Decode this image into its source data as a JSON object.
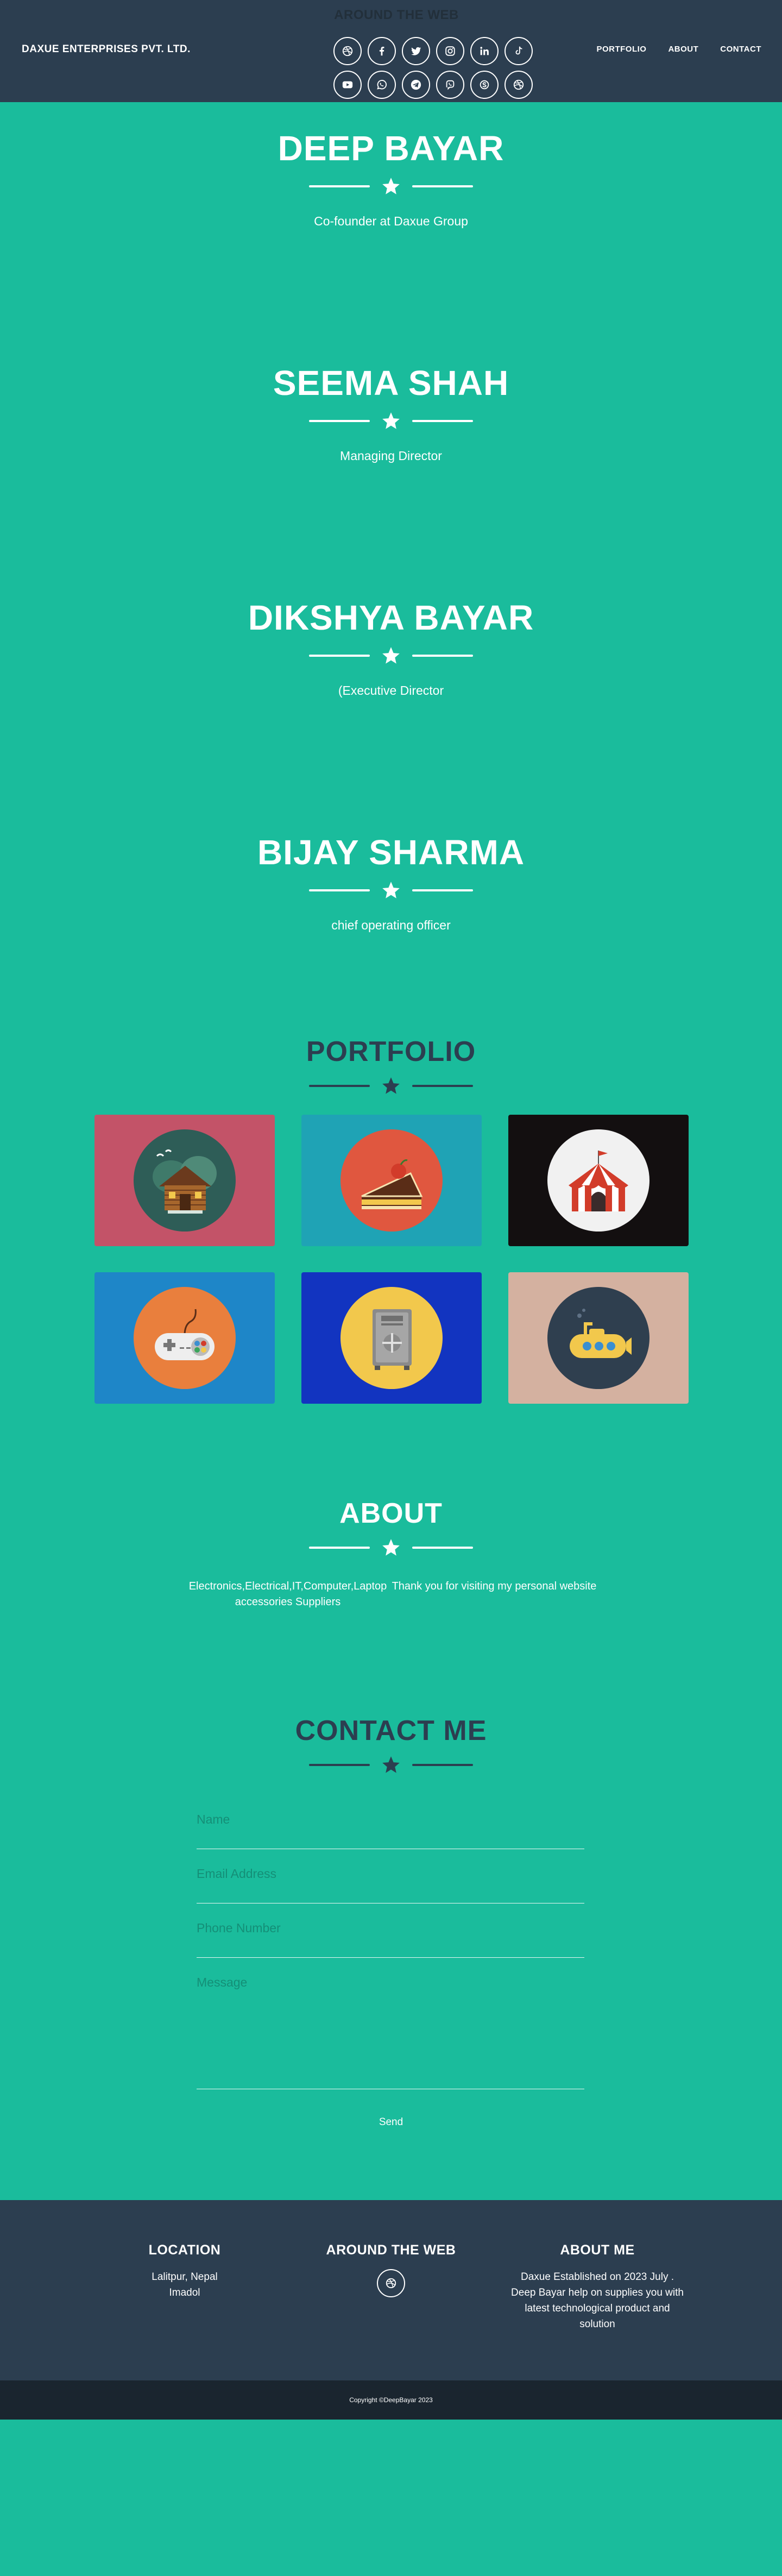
{
  "nav": {
    "brand": "DAXUE ENTERPRISES PVT. LTD.",
    "links": [
      "PORTFOLIO",
      "ABOUT",
      "CONTACT"
    ],
    "around_title": "AROUND THE WEB",
    "social_icons": [
      "dribbble-icon",
      "facebook-icon",
      "twitter-icon",
      "instagram-icon",
      "linkedin-icon",
      "tiktok-icon",
      "youtube-icon",
      "whatsapp-icon",
      "telegram-icon",
      "viber-icon",
      "skype-icon",
      "dribbble-icon"
    ]
  },
  "team": [
    {
      "name": "DEEP BAYAR",
      "role": "Co-founder at Daxue Group"
    },
    {
      "name": "SEEMA SHAH",
      "role": "Managing Director"
    },
    {
      "name": "DIKSHYA BAYAR",
      "role": "(Executive Director"
    },
    {
      "name": "BIJAY SHARMA",
      "role": "chief operating officer"
    }
  ],
  "portfolio": {
    "title": "PORTFOLIO",
    "items": [
      {
        "icon": "cabin-icon",
        "bg": "#c35368",
        "circle": "#2e5d57"
      },
      {
        "icon": "cake-icon",
        "bg": "#1fa3b5",
        "circle": "#e0573f"
      },
      {
        "icon": "circus-tent-icon",
        "bg": "#130f10",
        "circle": "#f1f1f1"
      },
      {
        "icon": "game-controller-icon",
        "bg": "#1e86c8",
        "circle": "#e97f3d"
      },
      {
        "icon": "safe-icon",
        "bg": "#1234c0",
        "circle": "#f2c84c"
      },
      {
        "icon": "submarine-icon",
        "bg": "#d4b1a0",
        "circle": "#2f3f4f"
      }
    ]
  },
  "about": {
    "title": "ABOUT",
    "left": "Electronics,Electrical,IT,Computer,Laptop accessories Suppliers",
    "right": "Thank you for visiting my personal website"
  },
  "contact": {
    "title": "CONTACT ME",
    "name_placeholder": "Name",
    "email_placeholder": "Email Address",
    "phone_placeholder": "Phone Number",
    "message_placeholder": "Message",
    "send_label": "Send"
  },
  "footer": {
    "location_title": "LOCATION",
    "location_text": "Lalitpur, Nepal Imadol",
    "web_title": "AROUND THE WEB",
    "web_icon": "dribbble-icon",
    "about_title": "ABOUT ME",
    "about_text": "Daxue Established on 2023 July . Deep Bayar help on supplies you with latest technological product and solution",
    "copyright": "Copyright ©DeepBayar 2023"
  },
  "colors": {
    "teal": "#1abc9c",
    "navy": "#2c3e50",
    "dark": "#1a252f"
  }
}
